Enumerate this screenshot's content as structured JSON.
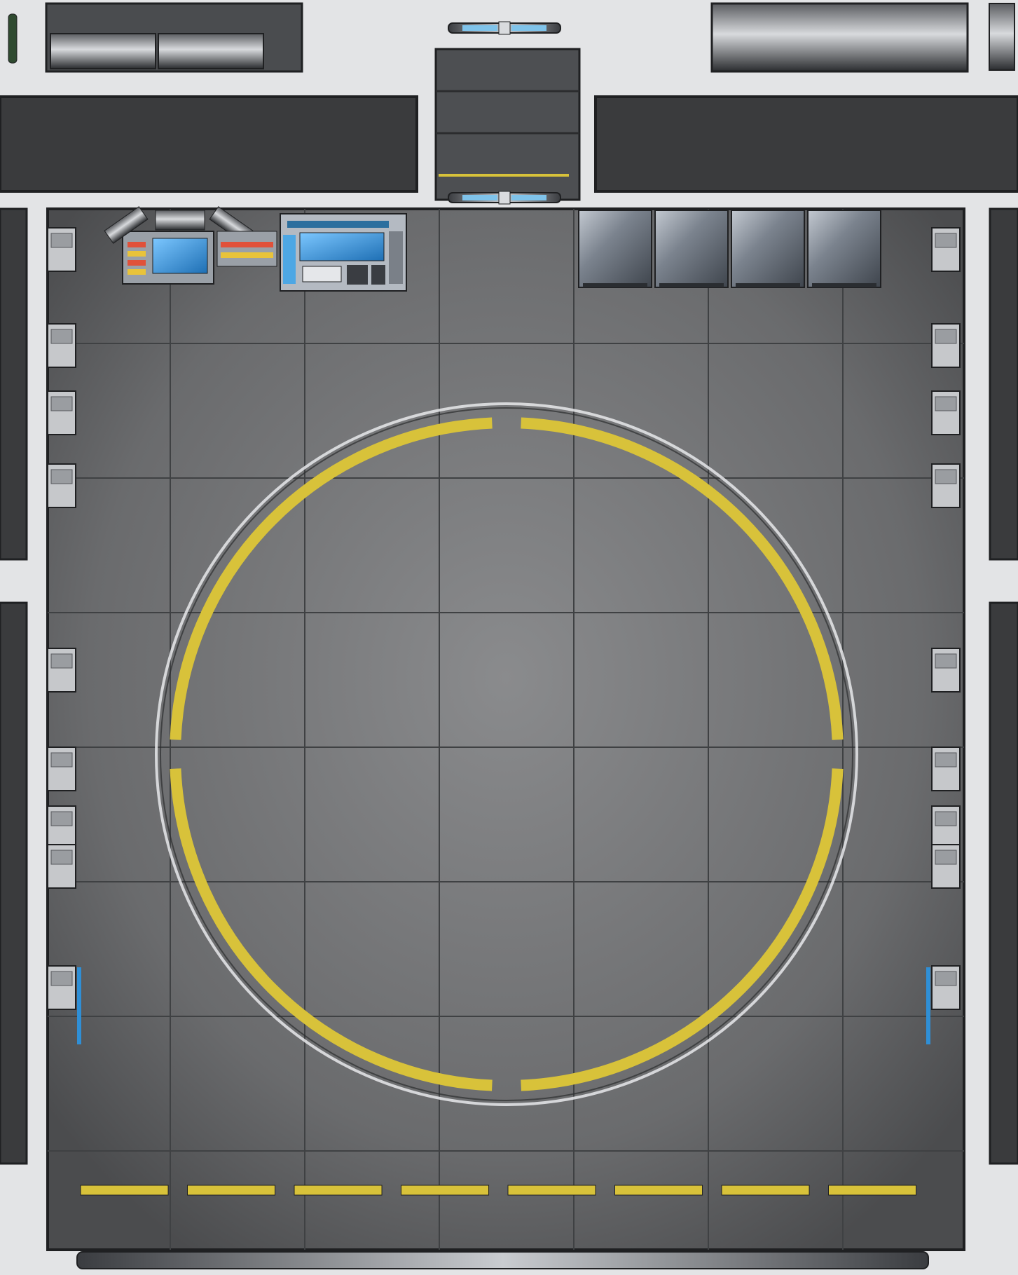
{
  "map": {
    "view": "top-down",
    "grid": true,
    "grid_columns": 7,
    "grid_rows": 8,
    "grid_line_color": "#3f4143",
    "floor_color": "#6e6f71",
    "wall_color": "#e3e4e6",
    "wall_trim_color": "#1f2022",
    "marking_color": "#d8c23a",
    "console_screen_color": "#2f8fd6"
  },
  "features": {
    "landing_pad": {
      "shape": "circle",
      "ring_segments": 4
    },
    "dashed_line": {
      "dash_count": 8
    },
    "upper_doors": {
      "count": 2
    },
    "cargo_containers": {
      "count": 4
    },
    "wall_panels_left": {
      "count": 9
    },
    "wall_panels_right": {
      "count": 9
    }
  },
  "icons": {
    "console": "computer-console-icon",
    "door": "sliding-door-icon",
    "container": "storage-container-icon"
  }
}
